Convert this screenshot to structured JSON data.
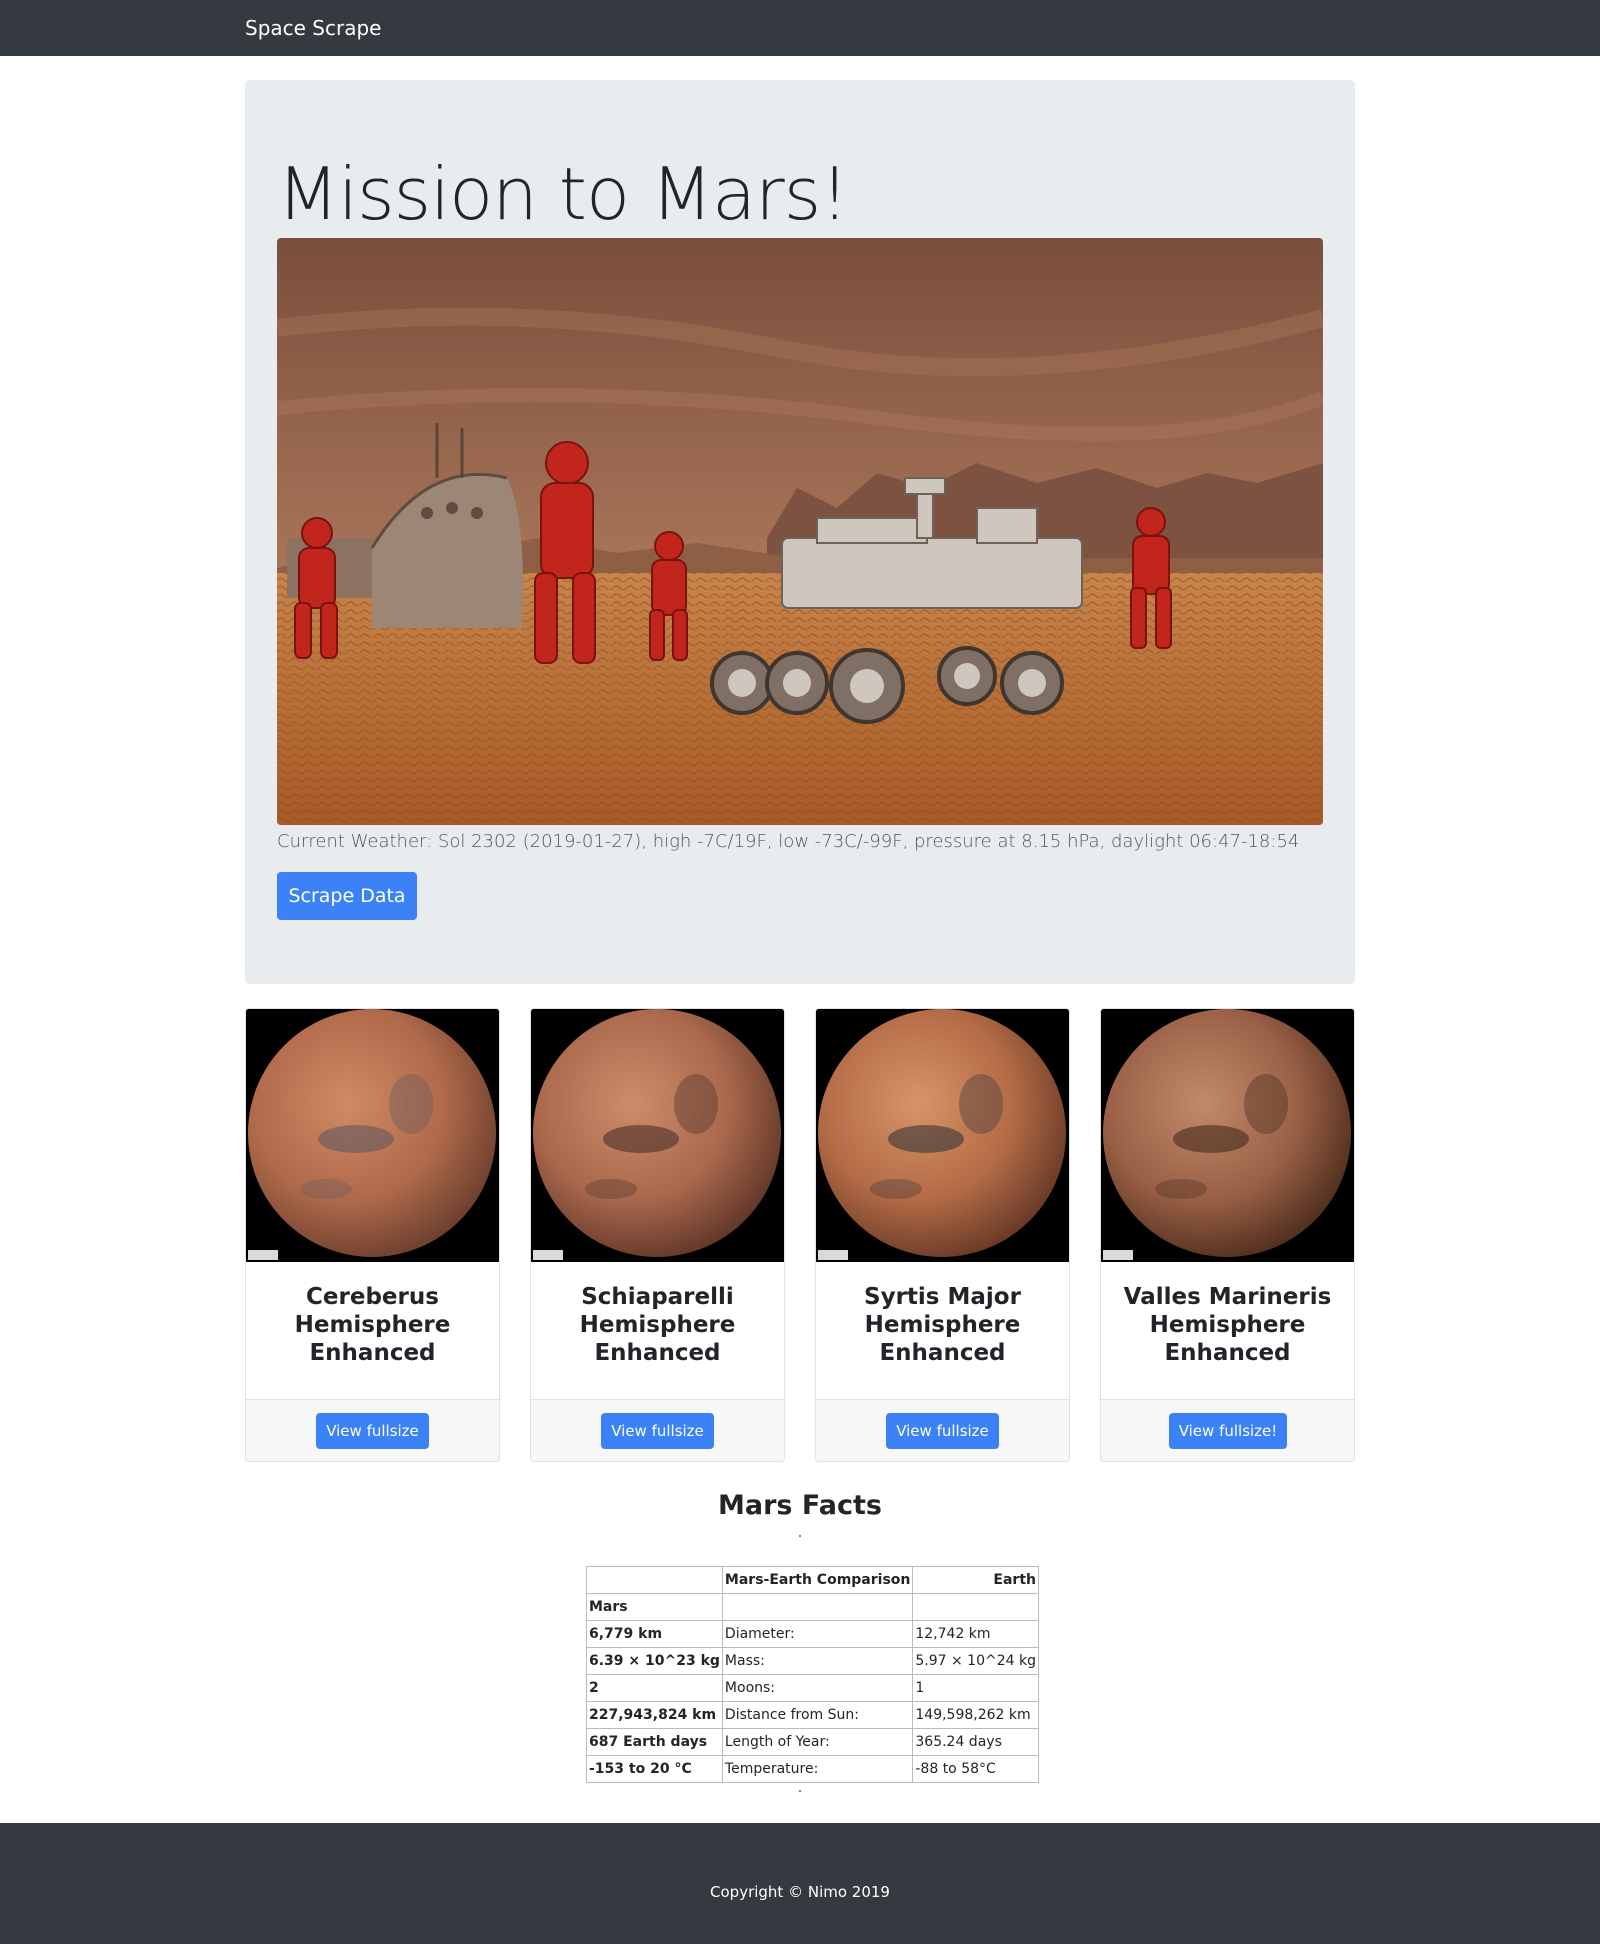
{
  "navbar": {
    "brand": "Space Scrape"
  },
  "jumbotron": {
    "title": "Mission to Mars!",
    "weather": "Current Weather: Sol 2302 (2019-01-27), high -7C/19F, low -73C/-99F, pressure at 8.15 hPa, daylight 06:47-18:54",
    "scrape_label": "Scrape Data"
  },
  "hemispheres": [
    {
      "title_lines": [
        "Cereberus",
        "Hemisphere",
        "Enhanced"
      ],
      "button": "View fullsize"
    },
    {
      "title_lines": [
        "Schiaparelli",
        "Hemisphere",
        "Enhanced"
      ],
      "button": "View fullsize"
    },
    {
      "title_lines": [
        "Syrtis Major",
        "Hemisphere",
        "Enhanced"
      ],
      "button": "View fullsize"
    },
    {
      "title_lines": [
        "Valles Marineris",
        "Hemisphere",
        "Enhanced"
      ],
      "button": "View fullsize!"
    }
  ],
  "facts": {
    "title": "Mars Facts",
    "headers": [
      "",
      "Mars-Earth Comparison",
      "Earth"
    ],
    "rows": [
      [
        "Mars",
        "",
        ""
      ],
      [
        "6,779 km",
        "Diameter:",
        "12,742 km"
      ],
      [
        "6.39 × 10^23 kg",
        "Mass:",
        "5.97 × 10^24 kg"
      ],
      [
        "2",
        "Moons:",
        "1"
      ],
      [
        "227,943,824 km",
        "Distance from Sun:",
        "149,598,262 km"
      ],
      [
        "687 Earth days",
        "Length of Year:",
        "365.24 days"
      ],
      [
        "-153 to 20 °C",
        "Temperature:",
        "-88 to 58°C"
      ]
    ]
  },
  "footer": {
    "copyright": "Copyright © Nimo 2019"
  },
  "colors": {
    "navbar": "#343a40",
    "jumbotron": "#e9ecef",
    "button": "#3b82f6"
  },
  "planet_palettes": [
    {
      "light": "#d08a66",
      "mid": "#b06a4a",
      "dark": "#6e4030",
      "mark": "#5a5660"
    },
    {
      "light": "#cf8c6c",
      "mid": "#a9684c",
      "dark": "#64382a",
      "mark": "#3e2a22"
    },
    {
      "light": "#d89468",
      "mid": "#b36b45",
      "dark": "#6a3b28",
      "mark": "#2c3038"
    },
    {
      "light": "#c28a6a",
      "mid": "#9a6046",
      "dark": "#52301f",
      "mark": "#3a2418"
    }
  ]
}
